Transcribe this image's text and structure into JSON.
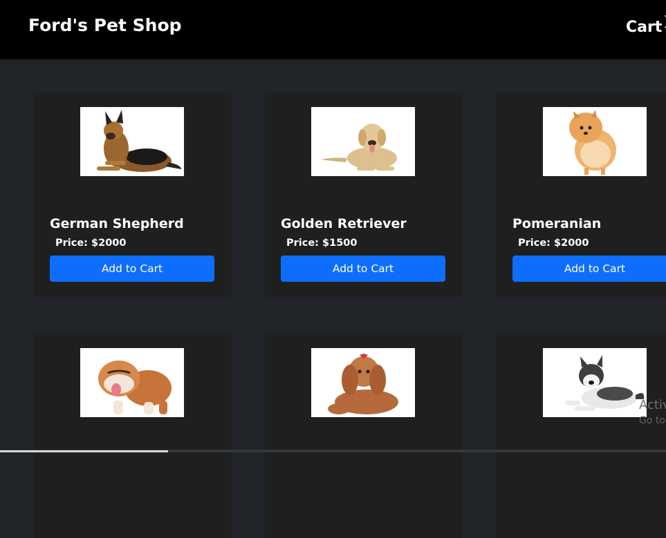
{
  "navbar": {
    "brand": "Ford's Pet Shop",
    "cart_label": "Cart"
  },
  "products": [
    {
      "name": "German Shepherd",
      "price": "Price: $2000",
      "button": "Add to Cart",
      "image_icon": "german-shepherd-dog-icon"
    },
    {
      "name": "Golden Retriever",
      "price": "Price: $1500",
      "button": "Add to Cart",
      "image_icon": "golden-retriever-dog-icon"
    },
    {
      "name": "Pomeranian",
      "price": "Price: $2000",
      "button": "Add to Cart",
      "image_icon": "pomeranian-dog-icon"
    },
    {
      "image_icon": "bulldog-icon"
    },
    {
      "image_icon": "poodle-dog-icon"
    },
    {
      "image_icon": "husky-dog-icon"
    }
  ],
  "os_overlay": {
    "line1": "Activ",
    "line2": "Go to"
  },
  "colors": {
    "navbar_bg": "#000000",
    "page_bg": "#212529",
    "card_bg": "#1f1f1f",
    "button_bg": "#0d6efd",
    "text": "#ffffff"
  }
}
